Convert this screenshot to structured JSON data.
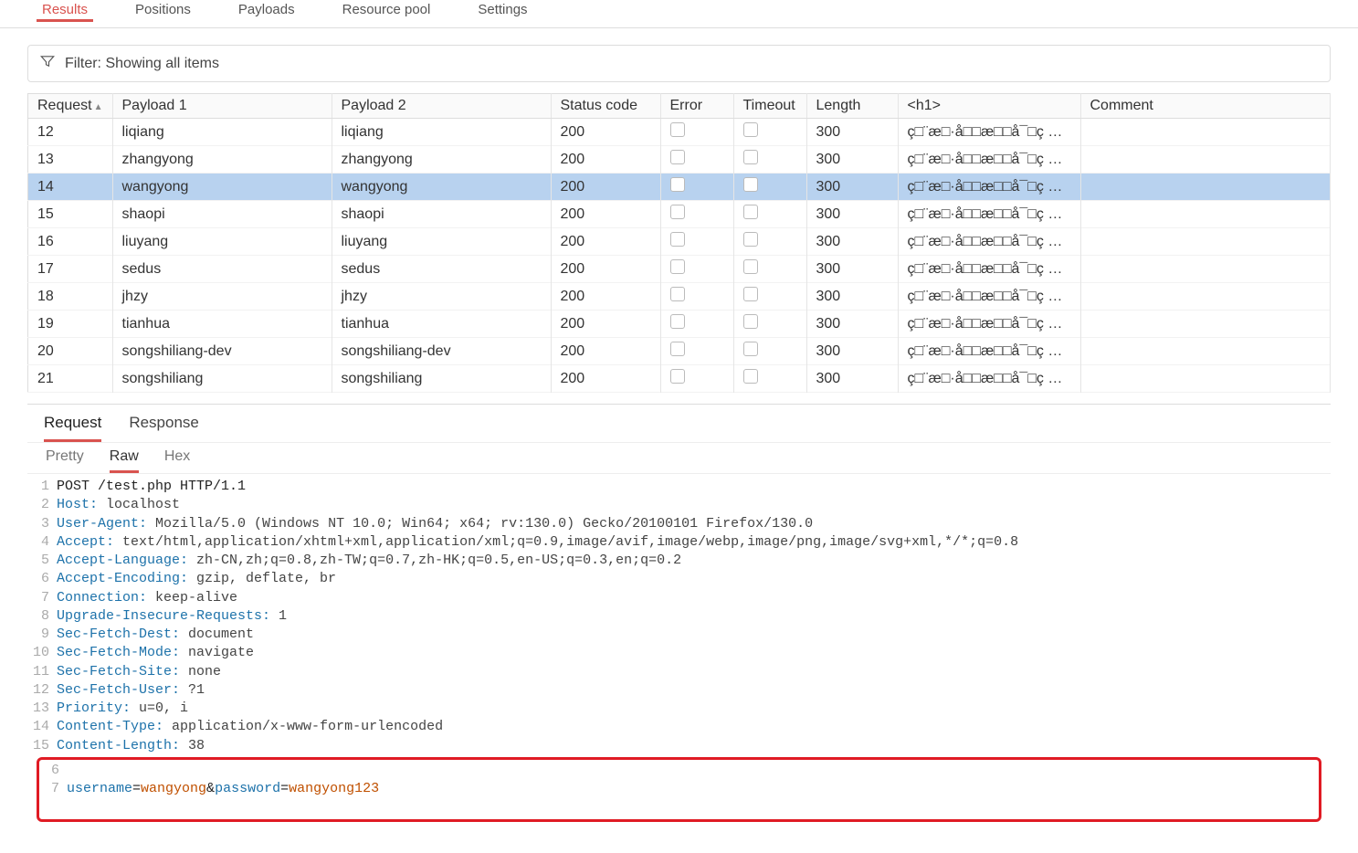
{
  "top_tabs": [
    "Results",
    "Positions",
    "Payloads",
    "Resource pool",
    "Settings"
  ],
  "filter_label": "Filter: Showing all items",
  "columns": [
    "Request",
    "Payload 1",
    "Payload 2",
    "Status code",
    "Error",
    "Timeout",
    "Length",
    "<h1>",
    "Comment"
  ],
  "selected_index": 2,
  "rows": [
    {
      "req": "12",
      "p1": "liqiang",
      "p2": "liqiang",
      "status": "200",
      "length": "300",
      "h1": "ç□¨æ□·å□□æ□□å¯□ç …"
    },
    {
      "req": "13",
      "p1": "zhangyong",
      "p2": "zhangyong",
      "status": "200",
      "length": "300",
      "h1": "ç□¨æ□·å□□æ□□å¯□ç …"
    },
    {
      "req": "14",
      "p1": "wangyong",
      "p2": "wangyong",
      "status": "200",
      "length": "300",
      "h1": "ç□¨æ□·å□□æ□□å¯□ç …"
    },
    {
      "req": "15",
      "p1": "shaopi",
      "p2": "shaopi",
      "status": "200",
      "length": "300",
      "h1": "ç□¨æ□·å□□æ□□å¯□ç …"
    },
    {
      "req": "16",
      "p1": "liuyang",
      "p2": "liuyang",
      "status": "200",
      "length": "300",
      "h1": "ç□¨æ□·å□□æ□□å¯□ç …"
    },
    {
      "req": "17",
      "p1": "sedus",
      "p2": "sedus",
      "status": "200",
      "length": "300",
      "h1": "ç□¨æ□·å□□æ□□å¯□ç …"
    },
    {
      "req": "18",
      "p1": "jhzy",
      "p2": "jhzy",
      "status": "200",
      "length": "300",
      "h1": "ç□¨æ□·å□□æ□□å¯□ç …"
    },
    {
      "req": "19",
      "p1": "tianhua",
      "p2": "tianhua",
      "status": "200",
      "length": "300",
      "h1": "ç□¨æ□·å□□æ□□å¯□ç …"
    },
    {
      "req": "20",
      "p1": "songshiliang-dev",
      "p2": "songshiliang-dev",
      "status": "200",
      "length": "300",
      "h1": "ç□¨æ□·å□□æ□□å¯□ç …"
    },
    {
      "req": "21",
      "p1": "songshiliang",
      "p2": "songshiliang",
      "status": "200",
      "length": "300",
      "h1": "ç□¨æ□·å□□æ□□å¯□ç …"
    }
  ],
  "detail_tabs": {
    "request": "Request",
    "response": "Response"
  },
  "view_tabs": {
    "pretty": "Pretty",
    "raw": "Raw",
    "hex": "Hex"
  },
  "raw_request": {
    "lines": [
      {
        "n": "1",
        "plain": "POST /test.php HTTP/1.1"
      },
      {
        "n": "2",
        "k": "Host:",
        "v": " localhost"
      },
      {
        "n": "3",
        "k": "User-Agent:",
        "v": " Mozilla/5.0 (Windows NT 10.0; Win64; x64; rv:130.0) Gecko/20100101 Firefox/130.0"
      },
      {
        "n": "4",
        "k": "Accept:",
        "v": " text/html,application/xhtml+xml,application/xml;q=0.9,image/avif,image/webp,image/png,image/svg+xml,*/*;q=0.8"
      },
      {
        "n": "5",
        "k": "Accept-Language:",
        "v": " zh-CN,zh;q=0.8,zh-TW;q=0.7,zh-HK;q=0.5,en-US;q=0.3,en;q=0.2"
      },
      {
        "n": "6",
        "k": "Accept-Encoding:",
        "v": " gzip, deflate, br"
      },
      {
        "n": "7",
        "k": "Connection:",
        "v": " keep-alive"
      },
      {
        "n": "8",
        "k": "Upgrade-Insecure-Requests:",
        "v": " 1"
      },
      {
        "n": "9",
        "k": "Sec-Fetch-Dest:",
        "v": " document"
      },
      {
        "n": "10",
        "k": "Sec-Fetch-Mode:",
        "v": " navigate"
      },
      {
        "n": "11",
        "k": "Sec-Fetch-Site:",
        "v": " none"
      },
      {
        "n": "12",
        "k": "Sec-Fetch-User:",
        "v": " ?1"
      },
      {
        "n": "13",
        "k": "Priority:",
        "v": " u=0, i"
      },
      {
        "n": "14",
        "k": "Content-Type:",
        "v": " application/x-www-form-urlencoded"
      },
      {
        "n": "15",
        "k": "Content-Length:",
        "v": " 38"
      }
    ],
    "body": {
      "blank_n": "6",
      "body_n": "7",
      "parts": [
        {
          "k": "username",
          "sep": "=",
          "v": "wangyong"
        },
        {
          "sep": "&"
        },
        {
          "k": "password",
          "sep": "=",
          "v": "wangyong123"
        }
      ]
    }
  }
}
